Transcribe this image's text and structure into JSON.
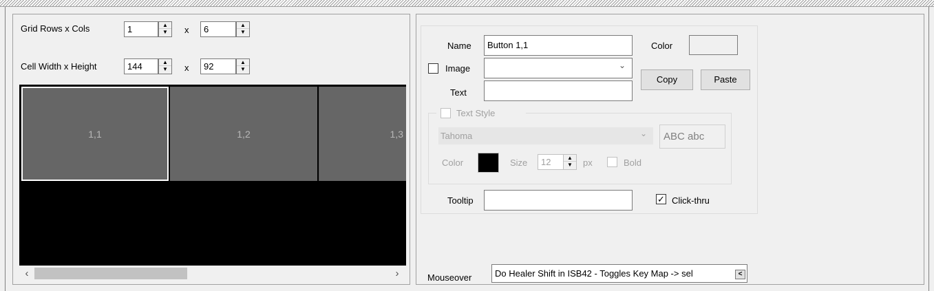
{
  "grid": {
    "rows_cols_label": "Grid Rows x Cols",
    "rows": "1",
    "cols": "6",
    "cell_size_label": "Cell Width x Height",
    "cell_width": "144",
    "cell_height": "92",
    "x_sep": "x",
    "cells": [
      "1,1",
      "1,2",
      "1,3"
    ]
  },
  "button": {
    "name_label": "Name",
    "name_value": "Button 1,1",
    "color_label": "Color",
    "image_label": "Image",
    "image_value": "",
    "text_label": "Text",
    "text_value": "",
    "copy_label": "Copy",
    "paste_label": "Paste"
  },
  "text_style": {
    "label": "Text Style",
    "font": "Tahoma",
    "preview": "ABC abc",
    "color_label": "Color",
    "size_label": "Size",
    "size_value": "12",
    "unit": "px",
    "bold_label": "Bold",
    "text_color": "#000000"
  },
  "tooltip": {
    "label": "Tooltip",
    "value": "",
    "clickthru_label": "Click-thru",
    "clickthru_checked": "✓"
  },
  "mouseover": {
    "label": "Mouseover",
    "value": "Do Healer Shift in ISB42 - Toggles Key Map -> sel"
  },
  "icons": {
    "up": "▲",
    "down": "▼",
    "left": "‹",
    "right": "›",
    "dropdown": "⌄",
    "more": "<"
  }
}
